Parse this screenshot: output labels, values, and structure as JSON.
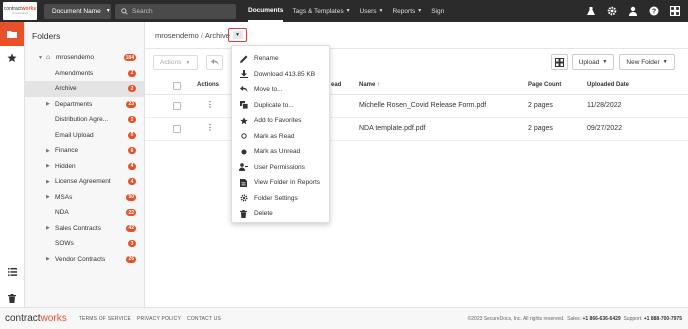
{
  "logo": {
    "word1": "contract",
    "word2": "works",
    "tagline": "by securedocs"
  },
  "topbar": {
    "doc_select": "Document Name",
    "search_placeholder": "Search",
    "nav": [
      {
        "label": "Documents",
        "active": true
      },
      {
        "label": "Tags & Templates",
        "active": false,
        "dropdown": true
      },
      {
        "label": "Users",
        "active": false,
        "dropdown": true
      },
      {
        "label": "Reports",
        "active": false,
        "dropdown": true
      },
      {
        "label": "Sign",
        "active": false
      }
    ],
    "icons": [
      "flask-icon",
      "gear-icon",
      "user-icon",
      "help-icon",
      "apps-grid-icon"
    ]
  },
  "folders": {
    "title": "Folders",
    "tree": [
      {
        "label": "mrosendemo",
        "count": "184",
        "level": 0,
        "expanded": true,
        "home": true
      },
      {
        "label": "Amendments",
        "count": "2",
        "level": 1
      },
      {
        "label": "Archive",
        "count": "2",
        "level": 1,
        "selected": true
      },
      {
        "label": "Departments",
        "count": "23",
        "level": 1,
        "collapsed": true
      },
      {
        "label": "Distribution Agre...",
        "count": "2",
        "level": 1
      },
      {
        "label": "Email Upload",
        "count": "0",
        "level": 1
      },
      {
        "label": "Finance",
        "count": "6",
        "level": 1,
        "collapsed": true
      },
      {
        "label": "Hidden",
        "count": "4",
        "level": 1,
        "collapsed": true
      },
      {
        "label": "License Agreement",
        "count": "4",
        "level": 1,
        "collapsed": true
      },
      {
        "label": "MSAs",
        "count": "50",
        "level": 1,
        "collapsed": true
      },
      {
        "label": "NDA",
        "count": "22",
        "level": 1
      },
      {
        "label": "Sales Contracts",
        "count": "42",
        "level": 1,
        "collapsed": true
      },
      {
        "label": "SOWs",
        "count": "3",
        "level": 1
      },
      {
        "label": "Vendor Contracts",
        "count": "26",
        "level": 1,
        "collapsed": true
      }
    ]
  },
  "breadcrumb": {
    "root": "mrosendemo",
    "separator": "/",
    "current": "Archive"
  },
  "toolbar": {
    "actions": "Actions",
    "upload": "Upload",
    "new_folder": "New Folder"
  },
  "table": {
    "headers": {
      "actions": "Actions",
      "read": "ead",
      "name": "Name",
      "page_count": "Page Count",
      "uploaded": "Uploaded Date"
    },
    "rows": [
      {
        "name": "Michelle Rosen_Covid Release Form.pdf",
        "pages": "2 pages",
        "date": "11/28/2022"
      },
      {
        "name": "NDA template.pdf.pdf",
        "pages": "2 pages",
        "date": "09/27/2022"
      }
    ]
  },
  "menu": [
    {
      "icon": "pencil-icon",
      "label": "Rename"
    },
    {
      "icon": "download-icon",
      "label": "Download 413.85 KB"
    },
    {
      "icon": "move-arrow-icon",
      "label": "Move to..."
    },
    {
      "icon": "copy-icon",
      "label": "Duplicate to..."
    },
    {
      "icon": "star-icon",
      "label": "Add to Favorites"
    },
    {
      "icon": "circle-outline-icon",
      "label": "Mark as Read"
    },
    {
      "icon": "circle-filled-icon",
      "label": "Mark as Unread"
    },
    {
      "icon": "user-permissions-icon",
      "label": "User Permissions"
    },
    {
      "icon": "report-icon",
      "label": "View Folder In Reports"
    },
    {
      "icon": "gear-icon",
      "label": "Folder Settings"
    },
    {
      "icon": "trash-icon",
      "label": "Delete"
    }
  ],
  "footer": {
    "brand1": "contract",
    "brand2": "works",
    "links": [
      "TERMS OF SERVICE",
      "PRIVACY POLICY",
      "CONTACT US"
    ],
    "copyright": "©2023 SecureDocs, Inc. All rights reserved.",
    "sales_label": "Sales:",
    "sales": "+1 866-636-6429",
    "support_label": "Support:",
    "support": "+1 888-700-7975"
  },
  "colors": {
    "accent": "#e8502a",
    "topbar": "#2b2b2b",
    "highlight_box": "#e03a3a"
  }
}
